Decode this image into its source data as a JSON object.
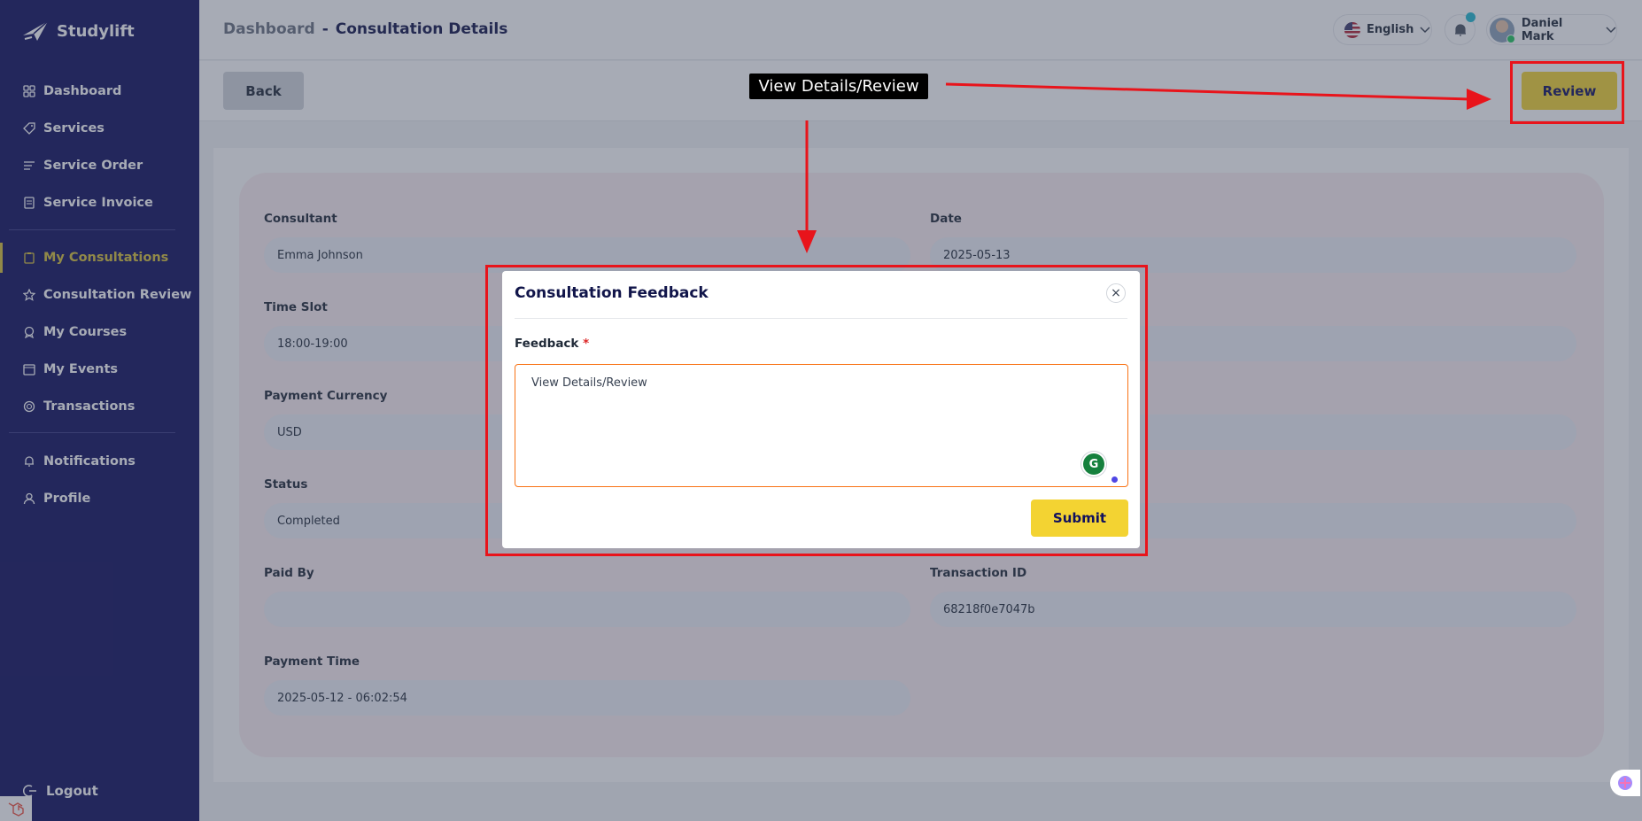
{
  "app": {
    "name": "Studylift"
  },
  "sidebar": {
    "items": [
      {
        "label": "Dashboard",
        "icon": "grid-icon"
      },
      {
        "label": "Services",
        "icon": "tag-icon"
      },
      {
        "label": "Service Order",
        "icon": "list-icon"
      },
      {
        "label": "Service Invoice",
        "icon": "document-icon"
      },
      {
        "label": "My Consultations",
        "icon": "clipboard-icon",
        "active": true
      },
      {
        "label": "Consultation Review",
        "icon": "star-icon"
      },
      {
        "label": "My Courses",
        "icon": "badge-icon"
      },
      {
        "label": "My Events",
        "icon": "calendar-icon"
      },
      {
        "label": "Transactions",
        "icon": "coins-icon"
      },
      {
        "label": "Notifications",
        "icon": "bell-icon"
      },
      {
        "label": "Profile",
        "icon": "user-icon"
      }
    ],
    "logout_label": "Logout"
  },
  "header": {
    "breadcrumb_root": "Dashboard",
    "breadcrumb_sep": "-",
    "breadcrumb_current": "Consultation Details",
    "language": "English",
    "user_name": "Daniel Mark"
  },
  "actions": {
    "back_label": "Back",
    "review_label": "Review"
  },
  "details": {
    "consultant_label": "Consultant",
    "consultant": "Emma Johnson",
    "date_label": "Date",
    "date": "2025-05-13",
    "time_slot_label": "Time Slot",
    "time_slot": "18:00-19:00",
    "payment_currency_label": "Payment Currency",
    "payment_currency": "USD",
    "status_label": "Status",
    "status": "Completed",
    "paid_by_label": "Paid By",
    "paid_by": "",
    "transaction_id_label": "Transaction ID",
    "transaction_id": "68218f0e7047b",
    "payment_time_label": "Payment Time",
    "payment_time": "2025-05-12 - 06:02:54"
  },
  "modal": {
    "title": "Consultation Feedback",
    "close_symbol": "×",
    "feedback_label": "Feedback",
    "required_mark": "*",
    "feedback_value": "View Details/Review",
    "submit_label": "Submit"
  },
  "annotation": {
    "label": "View Details/Review",
    "color": "#e8141b"
  },
  "colors": {
    "sidebar_bg": "#10105e",
    "accent": "#f3d332",
    "active_nav": "#d7c23a"
  }
}
